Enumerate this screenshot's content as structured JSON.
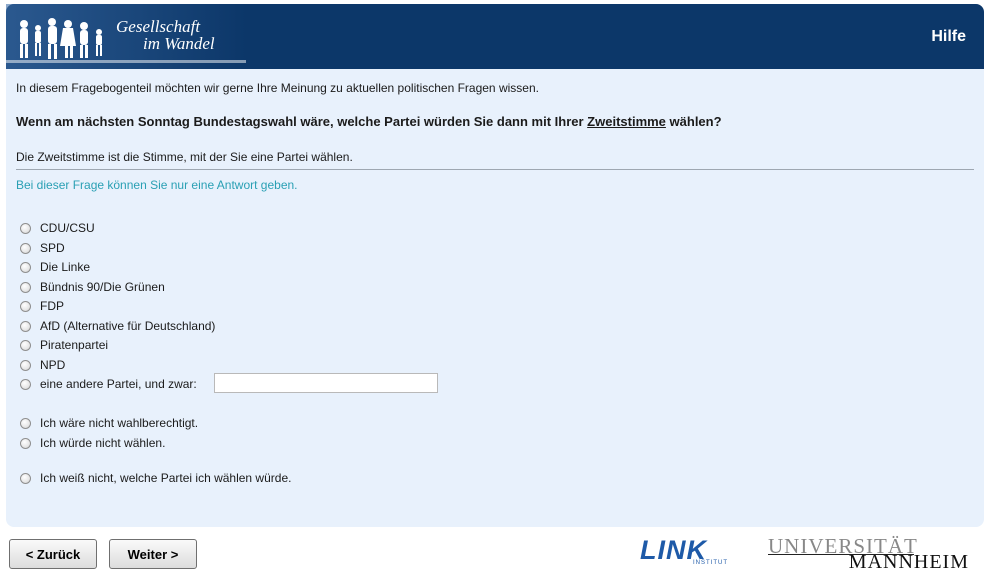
{
  "header": {
    "logo_line1": "Gesellschaft",
    "logo_line2": "im Wandel",
    "help_label": "Hilfe"
  },
  "survey": {
    "intro": "In diesem Fragebogenteil möchten wir gerne Ihre Meinung zu aktuellen politischen Fragen wissen.",
    "question_before": "Wenn am nächsten Sonntag Bundestagswahl wäre, welche Partei würden Sie dann mit Ihrer ",
    "question_underlined": "Zweitstimme",
    "question_after": " wählen?",
    "explanation": "Die Zweitstimme ist die Stimme, mit der Sie eine Partei wählen.",
    "hint": "Bei dieser Frage können Sie nur eine Antwort geben.",
    "options": [
      "CDU/CSU",
      "SPD",
      "Die Linke",
      "Bündnis 90/Die Grünen",
      "FDP",
      "AfD (Alternative für Deutschland)",
      "Piratenpartei",
      "NPD",
      "eine andere Partei, und zwar:",
      "Ich wäre nicht wahlberechtigt.",
      "Ich würde nicht wählen.",
      "Ich weiß nicht, welche Partei ich wählen würde."
    ],
    "other_party_value": ""
  },
  "nav": {
    "back_label": "< Zurück",
    "next_label": "Weiter >"
  },
  "footer": {
    "link_logo_main": "LINK",
    "link_logo_sub": "INSTITUT",
    "uni_logo_line1": "UNIVERSITÄT",
    "uni_logo_line2": "MANNHEIM"
  },
  "colors": {
    "header_bg": "#0c3769",
    "panel_bg": "#e8f1fc",
    "hint_text": "#2aa0b4",
    "link_blue": "#1e5aa8"
  }
}
